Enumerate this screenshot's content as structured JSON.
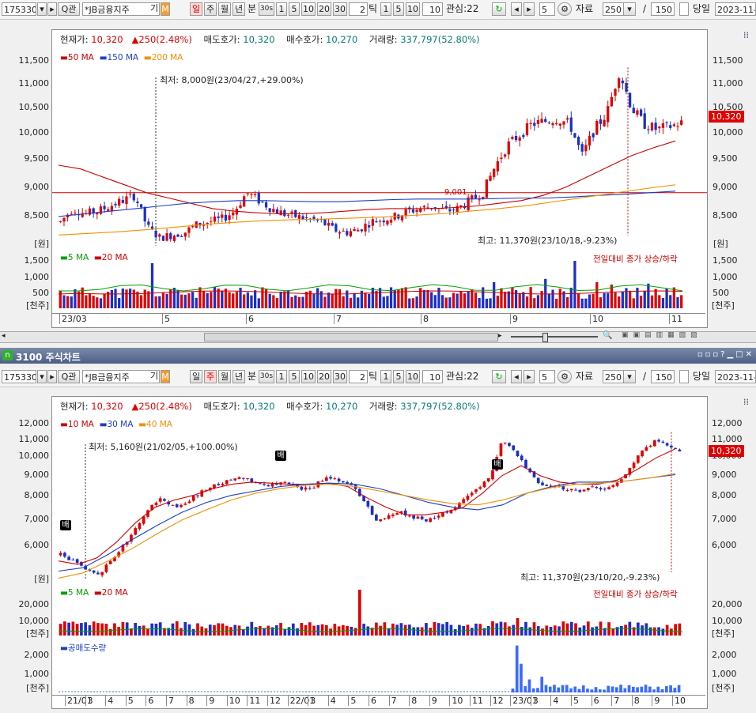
{
  "toolbar": {
    "code": "175330",
    "search_mark": "Q",
    "search_label": "관",
    "name": "*JB금융지주",
    "gi_label": "기",
    "m_label": "M",
    "periods": [
      "일",
      "주",
      "월",
      "년"
    ],
    "bun_label": "분",
    "bun_sec": "30s",
    "minute_btns": [
      "1",
      "5",
      "10",
      "20",
      "30"
    ],
    "tick_field": "2",
    "tick_label": "틱",
    "tick_btns": [
      "1",
      "5",
      "10"
    ],
    "tick_n": "10",
    "watch_label": "관심:22",
    "count_field": "5",
    "data_label": "자료",
    "data_count": "250",
    "slash": "/",
    "total": "150",
    "today_label": "당일",
    "date": "2023-11-"
  },
  "top": {
    "period_selected": "일",
    "info": {
      "price_label": "현재가:",
      "price": "10,320",
      "change": "▲250(2.48%)",
      "ask_label": "매도호가:",
      "ask": "10,320",
      "bid_label": "매수호가:",
      "bid": "10,270",
      "vol_label": "거래량:",
      "vol": "337,797(52.80%)"
    },
    "legend": [
      "50 MA",
      "150 MA",
      "200 MA"
    ],
    "vol_legend": [
      "5 MA",
      "20 MA"
    ],
    "vol_right_label": "전일대비 종가 상승/하락",
    "low_annot": "최저: 8,000원(23/04/27,+29.00%)",
    "high_annot": "최고: 11,370원(23/10/18,-9.23%)",
    "mid_annot": "9,001",
    "price_tag": "10,320",
    "y_ticks": [
      "11,500",
      "11,000",
      "10,500",
      "10,000",
      "9,500",
      "9,000",
      "8,500"
    ],
    "unit_label": "[원]",
    "vol_ticks": [
      "1,500",
      "1,000",
      "500"
    ],
    "vol_unit": "[천주]",
    "x_labels": [
      "23/03",
      "5",
      "6",
      "7",
      "8",
      "9",
      "10",
      "11"
    ]
  },
  "bottom": {
    "title_icon": "n",
    "title": "3100 주식차트",
    "period_selected": "주",
    "info": {
      "price_label": "현재가:",
      "price": "10,320",
      "change": "▲250(2.48%)",
      "ask_label": "매도호가:",
      "ask": "10,320",
      "bid_label": "매수호가:",
      "bid": "10,270",
      "vol_label": "거래량:",
      "vol": "337,797(52.80%)"
    },
    "legend": [
      "10 MA",
      "30 MA",
      "40 MA"
    ],
    "vol_legend": [
      "5 MA",
      "20 MA"
    ],
    "vol_right_label": "전일대비 종가 상승/하락",
    "short_legend": "공매도수량",
    "low_annot": "최저: 5,160원(21/02/05,+100.00%)",
    "high_annot": "최고: 11,370원(23/10/20,-9.23%)",
    "bae_mark": "배",
    "price_tag": "10,320",
    "y_ticks": [
      "12,000",
      "11,000",
      "10,000",
      "9,000",
      "8,000",
      "7,000",
      "6,000"
    ],
    "unit_label": "[원]",
    "vol_ticks": [
      "20,000",
      "10,000"
    ],
    "vol_unit": "[천주]",
    "short_ticks": [
      "2,000",
      "1,000"
    ],
    "short_unit": "[천주]",
    "x_labels": [
      "21/01",
      "3",
      "4",
      "5",
      "6",
      "7",
      "8",
      "9",
      "10",
      "11",
      "12",
      "22/01",
      "3",
      "4",
      "5",
      "6",
      "7",
      "8",
      "9",
      "10",
      "11",
      "12",
      "23/01",
      "3",
      "4",
      "5",
      "6",
      "7",
      "8",
      "9",
      "10"
    ]
  },
  "colors": {
    "up": "#e00000",
    "down": "#1a2fc8",
    "ma_short": "#cc0000",
    "ma_mid": "#1a3fc8",
    "ma_long": "#f09000",
    "vol_ma5": "#00a000",
    "short_bar": "#3a6bff"
  }
}
